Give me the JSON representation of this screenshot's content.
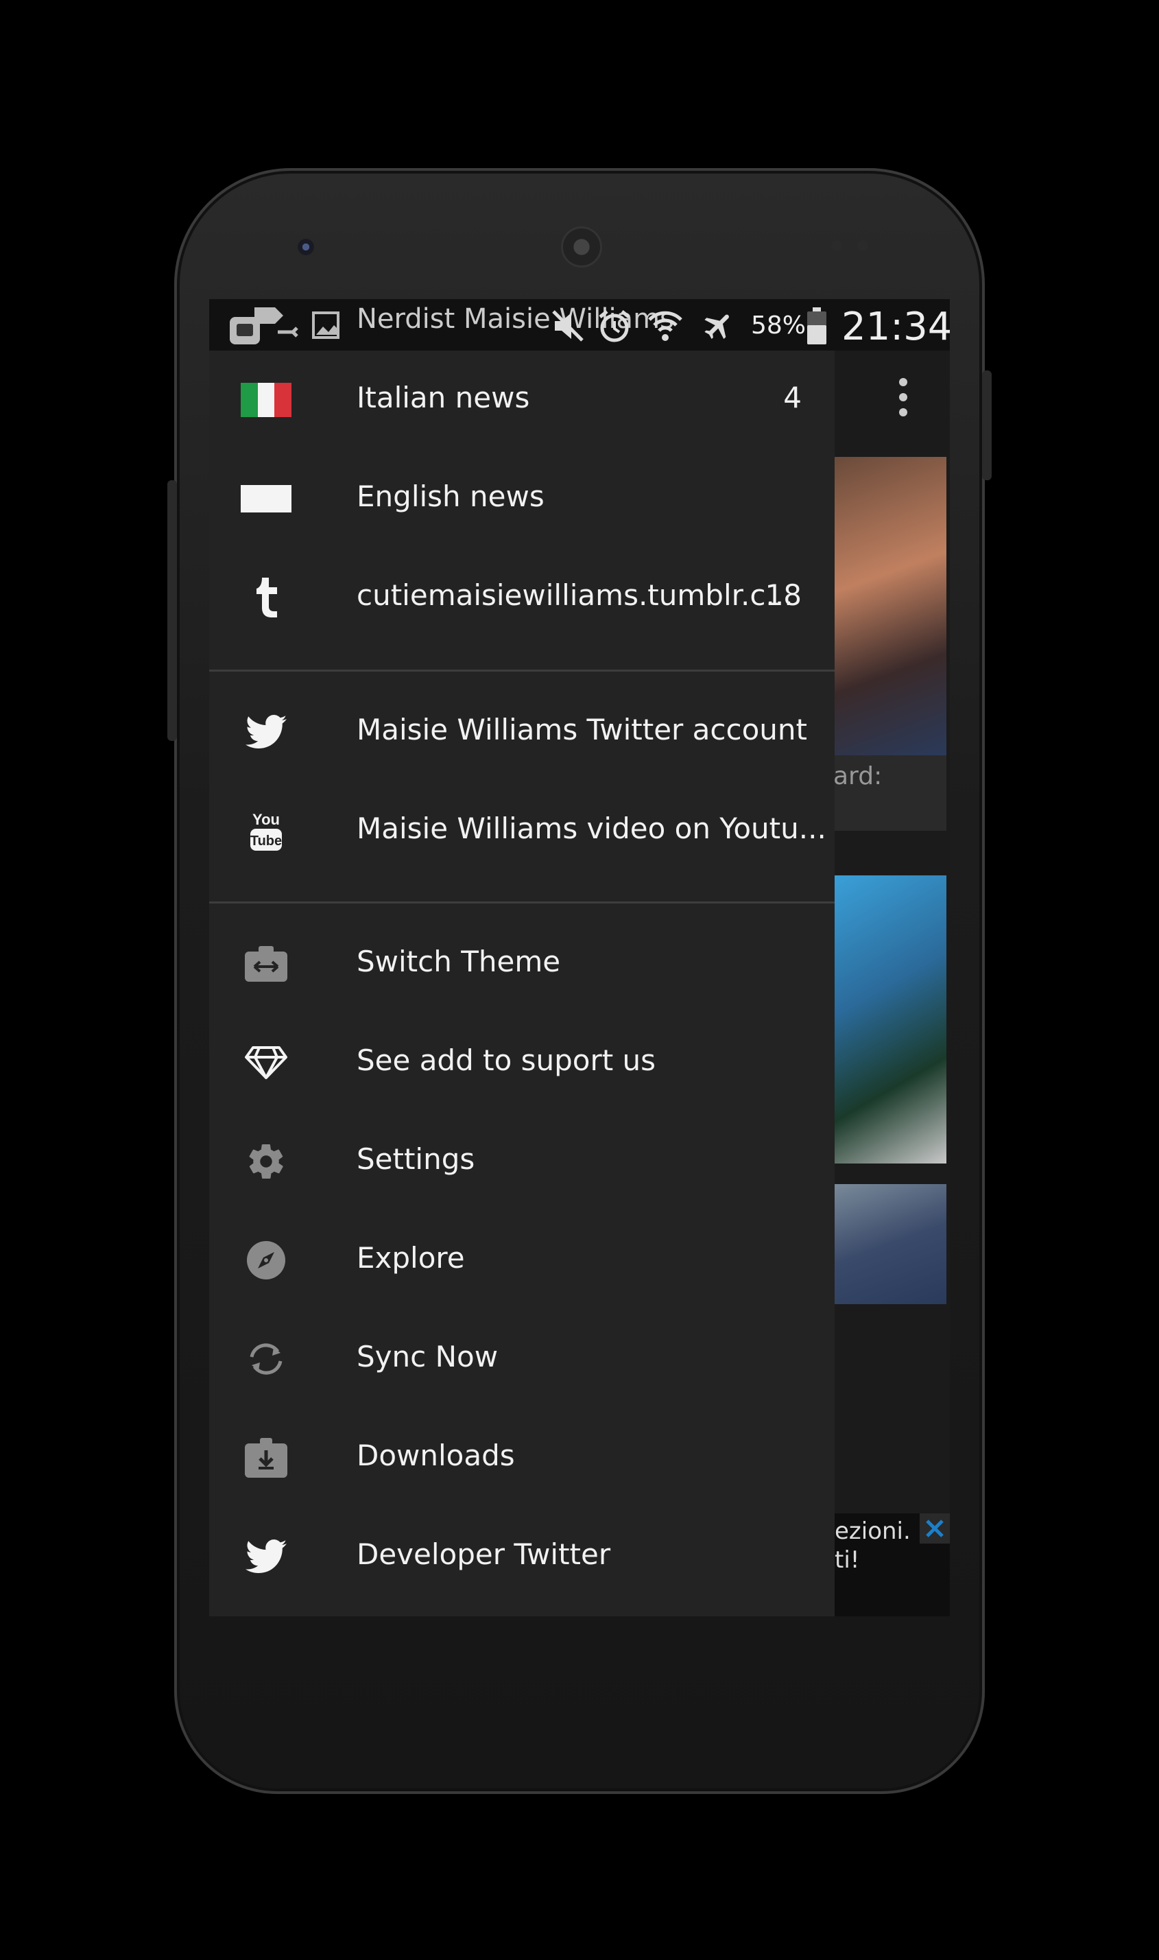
{
  "status_bar": {
    "notification_title": "Nerdist Maisie Williams",
    "battery_percent": "58%",
    "time": "21:34"
  },
  "drawer": {
    "feeds": [
      {
        "label": "Italian news",
        "count": "4",
        "icon": "italy-flag-icon"
      },
      {
        "label": "English news",
        "count": "",
        "icon": "uk-flag-icon"
      },
      {
        "label": "cutiemaisiewilliams.tumblr.c...",
        "count": "18",
        "icon": "tumblr-icon"
      }
    ],
    "social": [
      {
        "label": "Maisie Williams Twitter account",
        "icon": "twitter-icon"
      },
      {
        "label": "Maisie Williams video on Youtu...",
        "icon": "youtube-icon"
      }
    ],
    "actions": [
      {
        "label": "Switch Theme",
        "icon": "switch-theme-icon"
      },
      {
        "label": "See add to suport us",
        "icon": "diamond-icon"
      },
      {
        "label": "Settings",
        "icon": "gear-icon"
      },
      {
        "label": "Explore",
        "icon": "compass-icon"
      },
      {
        "label": "Sync Now",
        "icon": "sync-icon"
      },
      {
        "label": "Downloads",
        "icon": "downloads-icon"
      },
      {
        "label": "Developer Twitter",
        "icon": "twitter-icon"
      }
    ]
  },
  "background_app": {
    "card_fragment_1": "ard:",
    "ad_fragment_1": "ezioni.",
    "ad_fragment_2": "ti!"
  },
  "colors": {
    "drawer_bg": "#232323",
    "italy_green": "#1f9a46",
    "italy_red": "#d8323a",
    "ad_close": "#1e7fc8"
  }
}
